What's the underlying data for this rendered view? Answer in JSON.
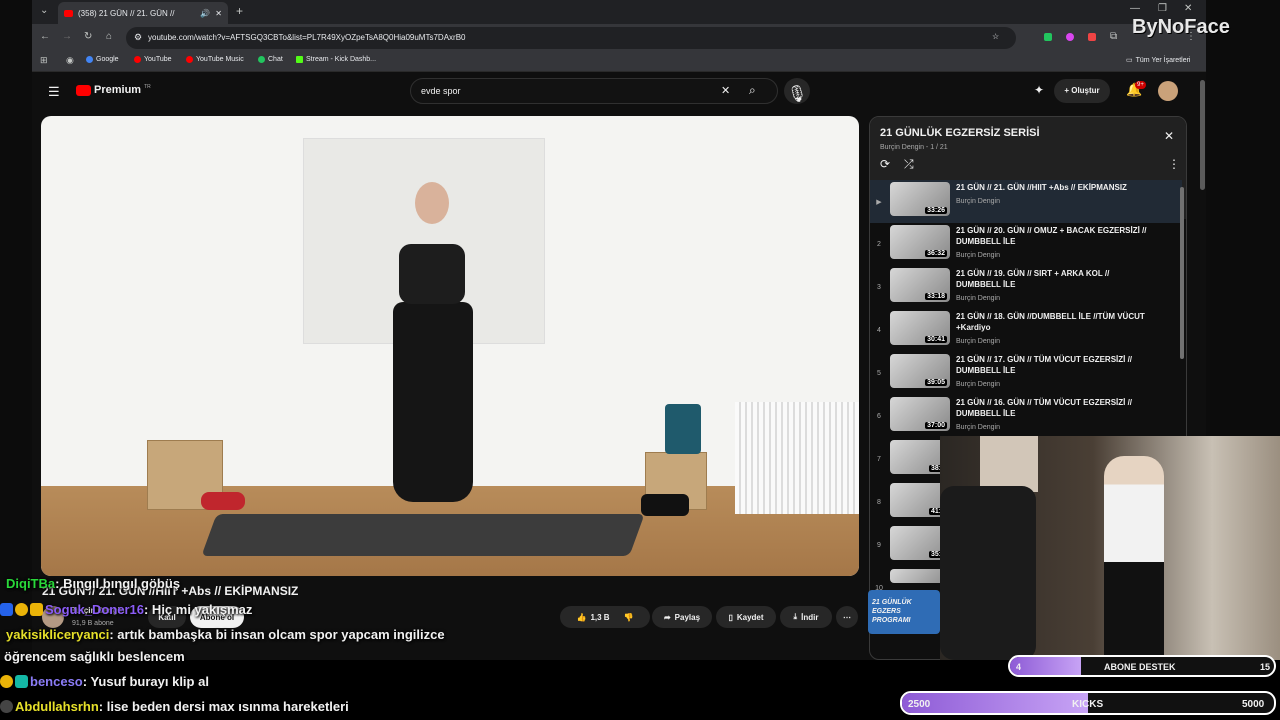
{
  "browser": {
    "tab_title": "(358) 21 GÜN // 21. GÜN //",
    "url": "youtube.com/watch?v=AFTSGQ3CBTo&list=PL7R49XyOZpeTsA8Q0Hia09uMTs7DAxrB0",
    "bookmarks": [
      "Google",
      "YouTube",
      "YouTube Music",
      "Chat",
      "Stream - Kick Dashb..."
    ],
    "all_bookmarks": "Tüm Yer İşaretleri"
  },
  "watermark": "ByNoFace",
  "youtube": {
    "logo": "Premium",
    "logo_tr": "TR",
    "search_value": "evde spor",
    "create_label": "Oluştur",
    "notif_count": "9+"
  },
  "video": {
    "title": "21 GÜN // 21. GÜN //HIIT +Abs // EKİPMANSIZ",
    "channel": "Burçin Dengin",
    "subs": "91,9 B abone",
    "join": "Katıl",
    "subscribe": "Abone ol",
    "likes": "1,3 B",
    "share": "Paylaş",
    "save": "Kaydet",
    "download": "İndir"
  },
  "playlist": {
    "title": "21 GÜNLÜK EGZERSİZ SERİSİ",
    "meta": "Burçin Dengin - 1 / 21",
    "items": [
      {
        "num": "▶",
        "title": "21 GÜN // 21. GÜN //HIIT +Abs // EKİPMANSIZ",
        "channel": "Burçin Dengin",
        "duration": "33:26"
      },
      {
        "num": "2",
        "title": "21 GÜN // 20. GÜN // OMUZ + BACAK EGZERSİZİ // DUMBBELL İLE",
        "channel": "Burçin Dengin",
        "duration": "36:32"
      },
      {
        "num": "3",
        "title": "21 GÜN // 19. GÜN // SIRT + ARKA KOL // DUMBBELL İLE",
        "channel": "Burçin Dengin",
        "duration": "33:18"
      },
      {
        "num": "4",
        "title": "21 GÜN // 18. GÜN //DUMBBELL İLE //TÜM VÜCUT +Kardiyo",
        "channel": "Burçin Dengin",
        "duration": "30:41"
      },
      {
        "num": "5",
        "title": "21 GÜN // 17. GÜN // TÜM VÜCUT EGZERSİZİ // DUMBBELL İLE",
        "channel": "Burçin Dengin",
        "duration": "39:05"
      },
      {
        "num": "6",
        "title": "21 GÜN // 16. GÜN // TÜM VÜCUT EGZERSİZİ // DUMBBELL İLE",
        "channel": "Burçin Dengin",
        "duration": "37:00"
      },
      {
        "num": "7",
        "title": "",
        "channel": "",
        "duration": "38:1"
      },
      {
        "num": "8",
        "title": "",
        "channel": "",
        "duration": "41:0"
      },
      {
        "num": "9",
        "title": "",
        "channel": "",
        "duration": "35:1"
      },
      {
        "num": "10",
        "title": "",
        "channel": "",
        "duration": ""
      }
    ],
    "promo": "21 GÜNLÜK EGZERS PROGRAMI"
  },
  "chat": [
    {
      "user": "DiqiTBa",
      "msg": ": Bıngıl bıngıl göbüş",
      "color": "#29d93a"
    },
    {
      "user": "Soguk_Doner16",
      "msg": ": Hiç mi yakışmaz",
      "color": "#8b5cf6"
    },
    {
      "user": "yakisikliceryanci",
      "msg": ": artık bambaşka bi insan olcam spor yapcam ingilizce",
      "color": "#e6e02a"
    },
    {
      "user": "",
      "msg": "öğrencem sağlıklı beslencem",
      "color": "#ffffff"
    },
    {
      "user": "benceso",
      "msg": ": Yusuf burayı klip al",
      "color": "#8b7cf6"
    },
    {
      "user": "Abdullahsrhn",
      "msg": ": lise beden dersi max ısınma hareketleri",
      "color": "#e6e02a"
    }
  ],
  "goals": {
    "sub_label": "ABONE DESTEK",
    "sub_current": "4",
    "sub_target": "15",
    "sub_progress": 0.27,
    "kick_label": "KICKS",
    "kick_current": "2500",
    "kick_target": "5000",
    "kick_progress": 0.5
  },
  "colors": {
    "yt_red": "#ff0000",
    "accent": "#8e5bd6"
  }
}
